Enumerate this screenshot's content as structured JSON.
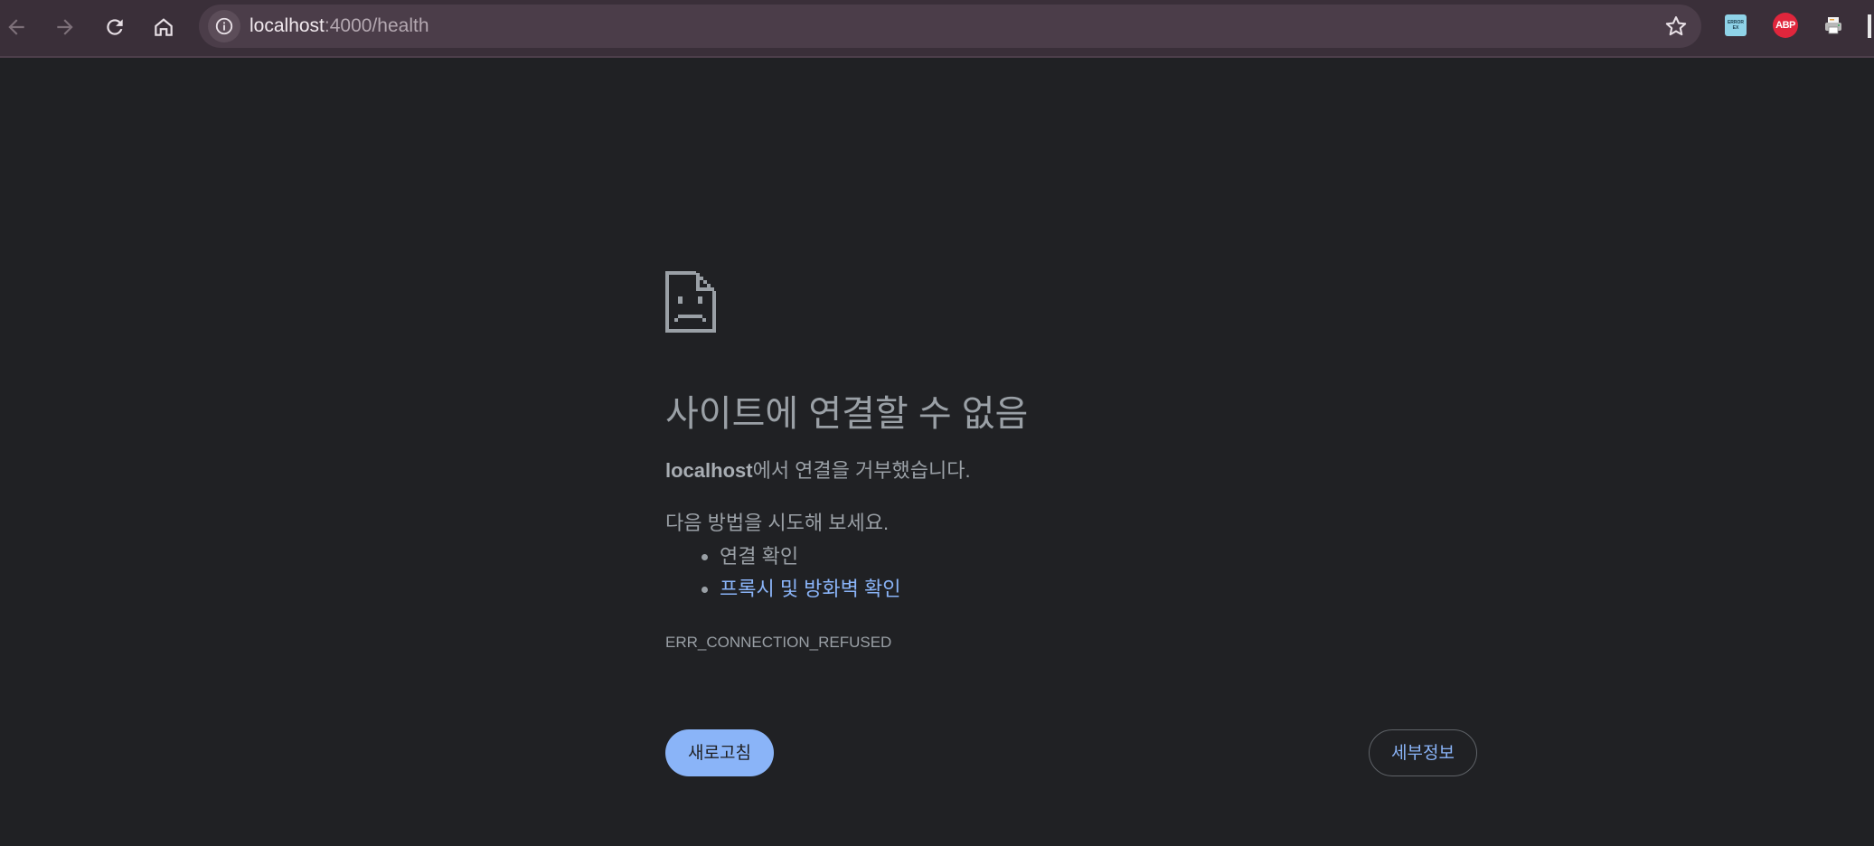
{
  "browser": {
    "url_host": "localhost",
    "url_rest": ":4000/health",
    "extensions": [
      {
        "name": "cc-ext-icon",
        "label": "ERROR EX"
      },
      {
        "name": "adblock-plus-icon",
        "label": "ABP"
      },
      {
        "name": "printer-icon",
        "label": ""
      }
    ]
  },
  "error_page": {
    "title": "사이트에 연결할 수 없음",
    "host": "localhost",
    "message_suffix": "에서 연결을 거부했습니다.",
    "try_label": "다음 방법을 시도해 보세요.",
    "suggestions": [
      {
        "label": "연결 확인",
        "is_link": false
      },
      {
        "label": "프록시 및 방화벽 확인",
        "is_link": true
      }
    ],
    "error_code": "ERR_CONNECTION_REFUSED",
    "reload_label": "새로고침",
    "details_label": "세부정보"
  },
  "colors": {
    "toolbar_bg": "#3a2f39",
    "omnibox_bg": "#4b3d49",
    "page_bg": "#202124",
    "text": "#9aa0a6",
    "accent": "#8ab4f8"
  }
}
